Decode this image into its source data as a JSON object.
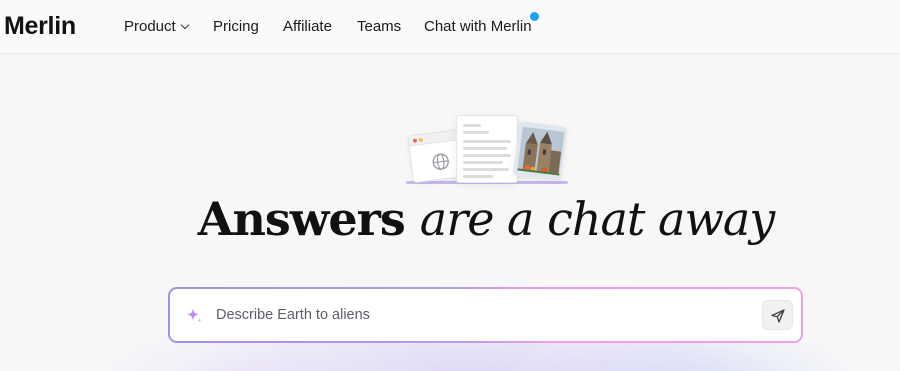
{
  "brand": {
    "name": "Merlin"
  },
  "nav": {
    "product": "Product",
    "pricing": "Pricing",
    "affiliate": "Affiliate",
    "teams": "Teams",
    "chat": "Chat with Merlin"
  },
  "hero": {
    "headline_strong": "Answers",
    "headline_soft": "are a chat away"
  },
  "search": {
    "placeholder": "Describe Earth to aliens",
    "value": ""
  },
  "icons": {
    "product_chevron": "chevron-down-icon",
    "chat_badge": "notification-dot",
    "sparkle": "sparkle-icon",
    "send": "send-icon",
    "globe": "globe-icon"
  },
  "colors": {
    "notification": "#1da1f2",
    "border_gradient_start": "#a58ee8",
    "border_gradient_end": "#f2a0e6",
    "sparkle": "#c58af0"
  }
}
